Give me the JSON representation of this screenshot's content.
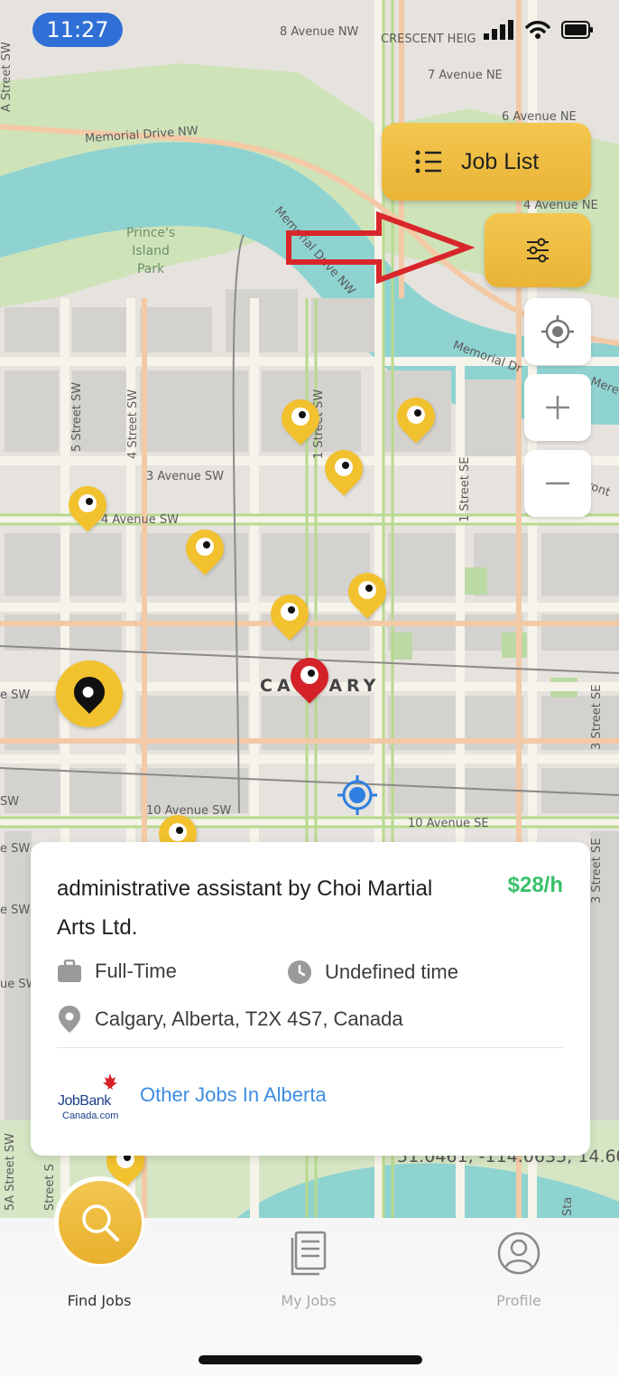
{
  "status_bar": {
    "time": "11:27"
  },
  "map": {
    "streets": [
      {
        "text": "8 Avenue NW"
      },
      {
        "text": "CRESCENT HEIG"
      },
      {
        "text": "7 Avenue NE"
      },
      {
        "text": "6 Avenue NE"
      },
      {
        "text": "Memorial Drive NW"
      },
      {
        "text": "Memorial Drive NW"
      },
      {
        "text": "4 Avenue NE"
      },
      {
        "text": "Memorial Dr"
      },
      {
        "text": "3 Avenue SW"
      },
      {
        "text": "4 Avenue SW"
      },
      {
        "text": "5 Street SW"
      },
      {
        "text": "4 Street SW"
      },
      {
        "text": "1 Street SW"
      },
      {
        "text": "1 Street SE"
      },
      {
        "text": "10 Avenue SW"
      },
      {
        "text": "10 Avenue SE"
      },
      {
        "text": "3 Street SE"
      },
      {
        "text": "3 Street SE"
      },
      {
        "text": "A Street SW"
      },
      {
        "text": "Mere"
      },
      {
        "text": "ront"
      },
      {
        "text": "e SW"
      },
      {
        "text": "e SW"
      },
      {
        "text": "SW"
      },
      {
        "text": "e SW"
      },
      {
        "text": "ue SW"
      },
      {
        "text": "5A Street SW"
      },
      {
        "text": "Street S"
      },
      {
        "text": "Sta"
      }
    ],
    "park_label": "Prince's\nIsland\nPark",
    "city_label": "CALGARY",
    "coordinate_readout": "51.0461, -114.0635, 14.60"
  },
  "controls": {
    "job_list_label": "Job List",
    "filter_icon": "sliders-icon",
    "locate_icon": "crosshair-icon",
    "zoom_in_icon": "plus-icon",
    "zoom_out_icon": "minus-icon"
  },
  "job_card": {
    "title": "administrative assistant by Choi Martial Arts Ltd.",
    "wage": "$28/h",
    "employment_type": "Full-Time",
    "schedule": "Undefined time",
    "location": "Calgary, Alberta, T2X 4S7, Canada",
    "logo_text_top": "JobBank",
    "logo_text_bottom": "Canada.com",
    "other_jobs_link": "Other Jobs In Alberta"
  },
  "bottom_nav": {
    "items": [
      {
        "label": "Find Jobs",
        "icon": "search-icon",
        "active": true
      },
      {
        "label": "My Jobs",
        "icon": "document-icon",
        "active": false
      },
      {
        "label": "Profile",
        "icon": "user-icon",
        "active": false
      }
    ]
  },
  "colors": {
    "accent": "#f2c12e",
    "wage_green": "#39c16a",
    "link_blue": "#3e8de0",
    "river": "#7fcfcf",
    "park": "#c9e0b4",
    "annotation_arrow": "#d8262b",
    "selected_pin": "#d52128"
  }
}
